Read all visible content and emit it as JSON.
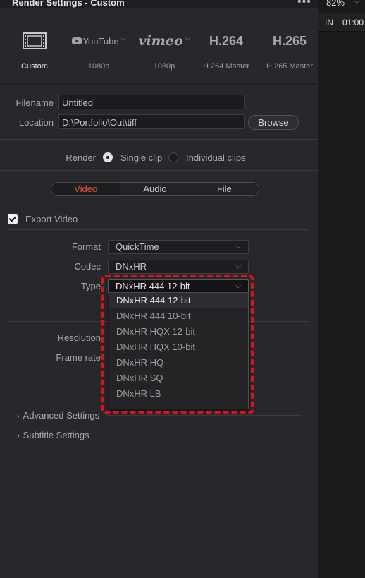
{
  "window": {
    "title": "Render Settings - Custom",
    "more_icon": "ellipsis-icon"
  },
  "viewer": {
    "zoom": "82%",
    "timecode_label": "IN",
    "timecode_value": "01:00"
  },
  "presets": [
    {
      "label": "Custom",
      "logo_text": "",
      "icon": "film-frame-icon",
      "selected": true
    },
    {
      "label": "1080p",
      "logo_text": "YouTube",
      "icon": "youtube-icon",
      "selected": false
    },
    {
      "label": "1080p",
      "logo_text": "vimeo",
      "icon": "vimeo-icon",
      "selected": false
    },
    {
      "label": "H.264 Master",
      "logo_text": "H.264",
      "icon": "",
      "selected": false
    },
    {
      "label": "H.265 Master",
      "logo_text": "H.265",
      "icon": "",
      "selected": false
    }
  ],
  "file": {
    "filename_label": "Filename",
    "filename_value": "Untitled",
    "location_label": "Location",
    "location_value": "D:\\Portfolio\\Out\\tiff",
    "browse_label": "Browse"
  },
  "render": {
    "label": "Render",
    "single_clip": "Single clip",
    "individual_clips": "Individual clips",
    "selected": "single"
  },
  "tabs": [
    "Video",
    "Audio",
    "File"
  ],
  "export_video": {
    "label": "Export Video",
    "checked": true
  },
  "format": {
    "label": "Format",
    "value": "QuickTime"
  },
  "codec": {
    "label": "Codec",
    "value": "DNxHR"
  },
  "type": {
    "label": "Type",
    "value": "DNxHR 444 12-bit",
    "options": [
      "DNxHR 444 12-bit",
      "DNxHR 444 10-bit",
      "DNxHR HQX 12-bit",
      "DNxHR HQX 10-bit",
      "DNxHR HQ",
      "DNxHR SQ",
      "DNxHR LB"
    ]
  },
  "resolution": {
    "label": "Resolution"
  },
  "frame_rate": {
    "label": "Frame rate"
  },
  "sections": {
    "advanced": "Advanced Settings",
    "subtitle": "Subtitle Settings"
  },
  "colors": {
    "accent": "#e8513f",
    "highlight": "#d8141b",
    "panel": "#28282c"
  }
}
